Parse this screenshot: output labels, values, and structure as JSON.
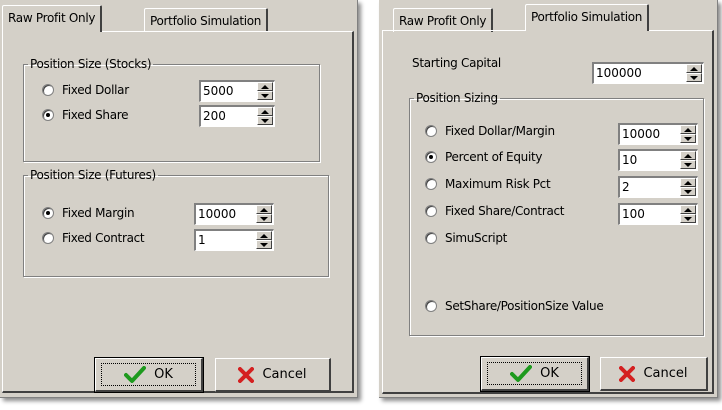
{
  "dialogs": [
    {
      "tabs": [
        {
          "label": "Raw Profit Only"
        },
        {
          "label": "Portfolio Simulation"
        }
      ],
      "stocks": {
        "title": "Position Size (Stocks)",
        "options": [
          {
            "label": "Fixed Dollar",
            "value": "5000",
            "selected": false
          },
          {
            "label": "Fixed Share",
            "value": "200",
            "selected": true
          }
        ]
      },
      "futures": {
        "title": "Position Size (Futures)",
        "options": [
          {
            "label": "Fixed Margin",
            "value": "10000",
            "selected": true
          },
          {
            "label": "Fixed Contract",
            "value": "1",
            "selected": false
          }
        ]
      },
      "buttons": {
        "ok": "OK",
        "cancel": "Cancel"
      }
    },
    {
      "tabs": [
        {
          "label": "Raw Profit Only"
        },
        {
          "label": "Portfolio Simulation"
        }
      ],
      "starting_capital": {
        "label": "Starting Capital",
        "value": "100000"
      },
      "sizing": {
        "title": "Position Sizing",
        "options": [
          {
            "label": "Fixed Dollar/Margin",
            "value": "10000",
            "selected": false
          },
          {
            "label": "Percent of Equity",
            "value": "10",
            "selected": true
          },
          {
            "label": "Maximum Risk Pct",
            "value": "2",
            "selected": false
          },
          {
            "label": "Fixed Share/Contract",
            "value": "100",
            "selected": false
          },
          {
            "label": "SimuScript",
            "selected": false
          },
          {
            "label": "SetShare/PositionSize Value",
            "selected": false
          }
        ]
      },
      "buttons": {
        "ok": "OK",
        "cancel": "Cancel"
      }
    }
  ],
  "colors": {
    "checkmark": "#1e9a1e",
    "cross": "#d42020",
    "dialog_bg": "#d4d0c8"
  }
}
